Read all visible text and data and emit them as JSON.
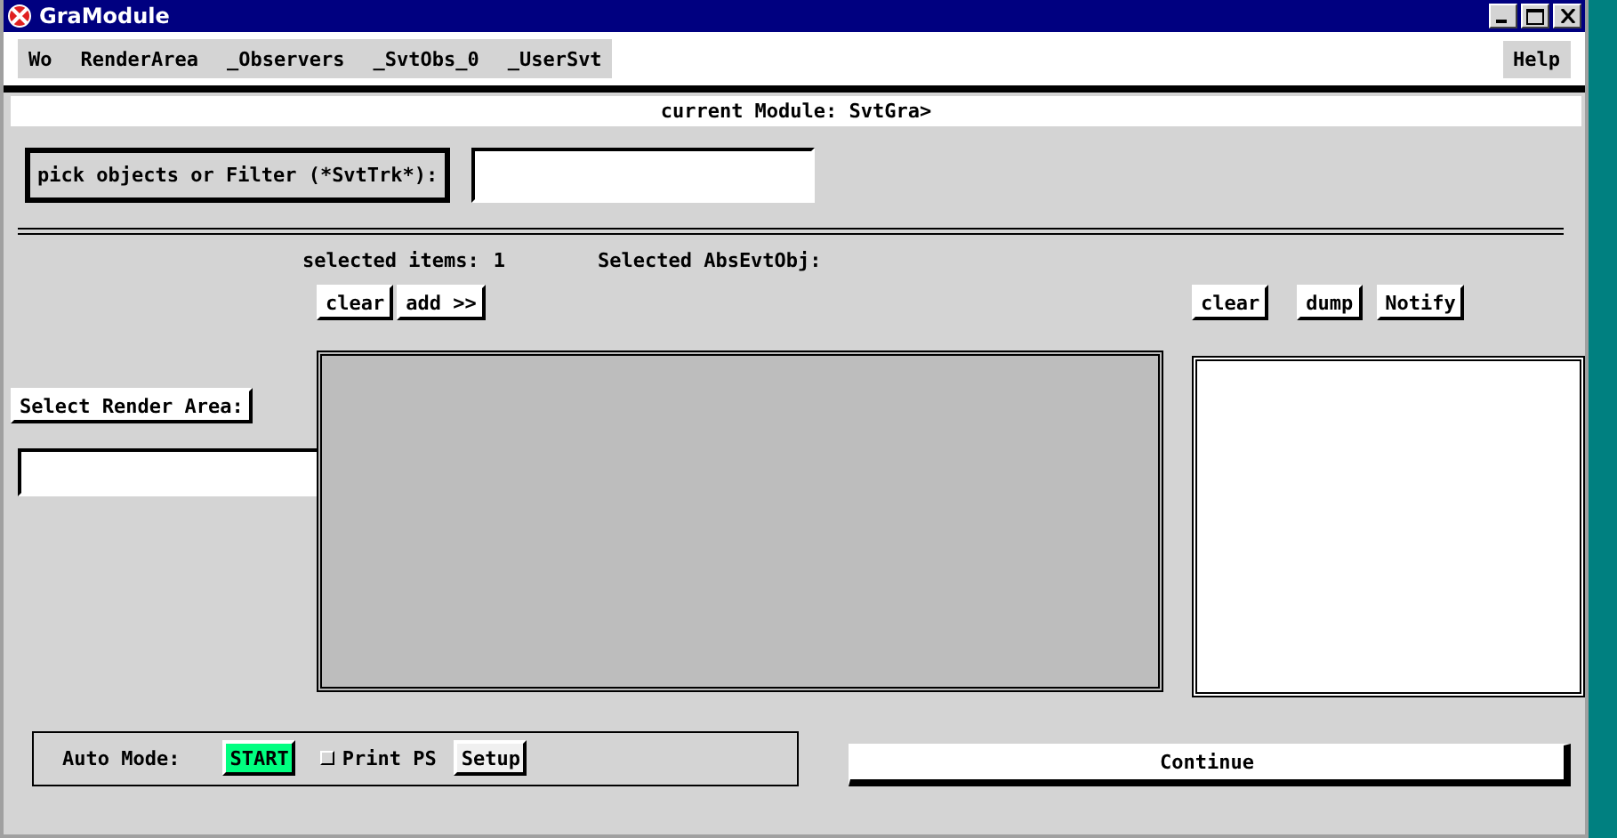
{
  "window": {
    "title": "GraModule"
  },
  "menu": {
    "items": [
      "Wo",
      "RenderArea",
      "_Observers",
      "_SvtObs_0",
      "_UserSvt"
    ],
    "help": "Help"
  },
  "current_module": "current Module: SvtGra>",
  "filter": {
    "label": "pick objects or Filter (*SvtTrk*):"
  },
  "selection": {
    "count_label": "selected items:",
    "count": "1",
    "objects_label": "Selected AbsEvtObj:",
    "buttons": [
      "clear",
      "add >>"
    ]
  },
  "render_area": {
    "button": "Select Render Area:"
  },
  "object_buttons": [
    "clear",
    "dump",
    "Notify"
  ],
  "auto_mode": {
    "label": "Auto Mode:",
    "start": "START",
    "print_ps": {
      "label": "Print PS",
      "checked": false
    },
    "setup": "Setup"
  },
  "continue": "Continue"
}
